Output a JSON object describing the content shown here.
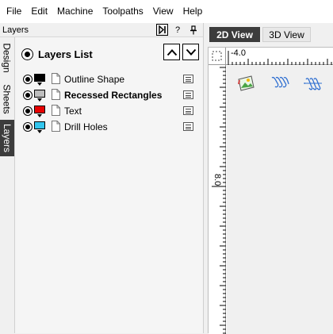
{
  "menubar": {
    "items": [
      "File",
      "Edit",
      "Machine",
      "Toolpaths",
      "View",
      "Help"
    ]
  },
  "panel": {
    "title": "Layers",
    "help_label": "?",
    "pin_glyph": "⊥",
    "dock_glyph": "⊳|"
  },
  "side_tabs": {
    "items": [
      {
        "label": "Design",
        "active": false
      },
      {
        "label": "Sheets",
        "active": false
      },
      {
        "label": "Layers",
        "active": true
      }
    ]
  },
  "layers_list": {
    "title": "Layers List",
    "layers": [
      {
        "name": "Outline Shape",
        "color": "#000000",
        "bold": false
      },
      {
        "name": "Recessed Rectangles",
        "color": "#bdbdbd",
        "bold": true
      },
      {
        "name": "Text",
        "color": "#e60000",
        "bold": false
      },
      {
        "name": "Drill Holes",
        "color": "#33c6ee",
        "bold": false
      }
    ]
  },
  "view_tabs": {
    "items": [
      {
        "label": "2D View",
        "active": true
      },
      {
        "label": "3D View",
        "active": false
      }
    ]
  },
  "rulers": {
    "top_label": "-4.0",
    "left_label": "8.0"
  },
  "toolbar_icons": [
    "image-import-icon",
    "spring-coil-icon",
    "spiral-coil-icon"
  ],
  "colors": {
    "active_tab": "#3c3c3c",
    "accent_blue": "#2f6fd1"
  }
}
